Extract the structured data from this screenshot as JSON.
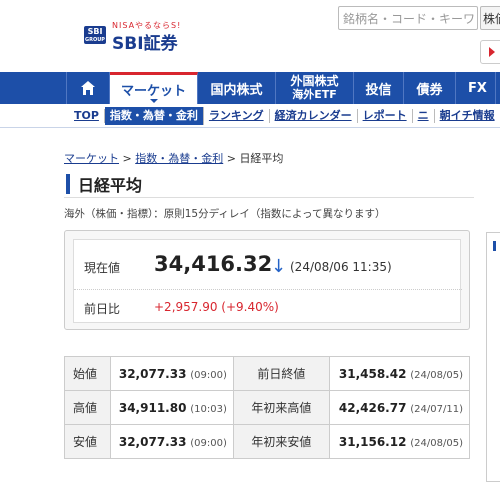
{
  "header": {
    "logo_tagline": "NISAやるならS!",
    "logo_badge": "SBI",
    "logo_badge_sub": "GROUP",
    "logo_text": "SBI証券",
    "search_placeholder": "銘柄名・コード・キーワ",
    "search_select": "株価"
  },
  "main_nav": {
    "market": "マーケット",
    "domestic": "国内株式",
    "foreign_line1": "外国株式",
    "foreign_line2": "海外ETF",
    "invest": "投信",
    "bond": "債券",
    "fx": "FX"
  },
  "sub_nav": {
    "items": [
      "TOP",
      "指数・為替・金利",
      "ランキング",
      "経済カレンダー",
      "レポート",
      "ニ",
      "朝イチ情報",
      "ニ"
    ]
  },
  "breadcrumb": {
    "level1": "マーケット",
    "sep": " > ",
    "level2": "指数・為替・金利",
    "current": "日経平均"
  },
  "page": {
    "title": "日経平均",
    "note": "海外（株価・指標）：原則15分ディレイ（指数によって異なります）"
  },
  "price": {
    "label_now": "現在値",
    "value": "34,416.32",
    "arrow": "↓",
    "timestamp": "(24/08/06 11:35)",
    "label_prev": "前日比",
    "change": "+2,957.90 (+9.40%)"
  },
  "stats": {
    "rows": [
      {
        "k1": "始値",
        "v1": "32,077.33",
        "t1": "(09:00)",
        "k2": "前日終値",
        "v2": "31,458.42",
        "t2": "(24/08/05)"
      },
      {
        "k1": "高値",
        "v1": "34,911.80",
        "t1": "(10:03)",
        "k2": "年初来高値",
        "v2": "42,426.77",
        "t2": "(24/07/11)"
      },
      {
        "k1": "安値",
        "v1": "32,077.33",
        "t1": "(09:00)",
        "k2": "年初来安値",
        "v2": "31,156.12",
        "t2": "(24/08/05)"
      }
    ]
  },
  "colors": {
    "brand_blue": "#1d4fa8",
    "accent_red": "#d8262f",
    "down_arrow": "#2563c7"
  }
}
